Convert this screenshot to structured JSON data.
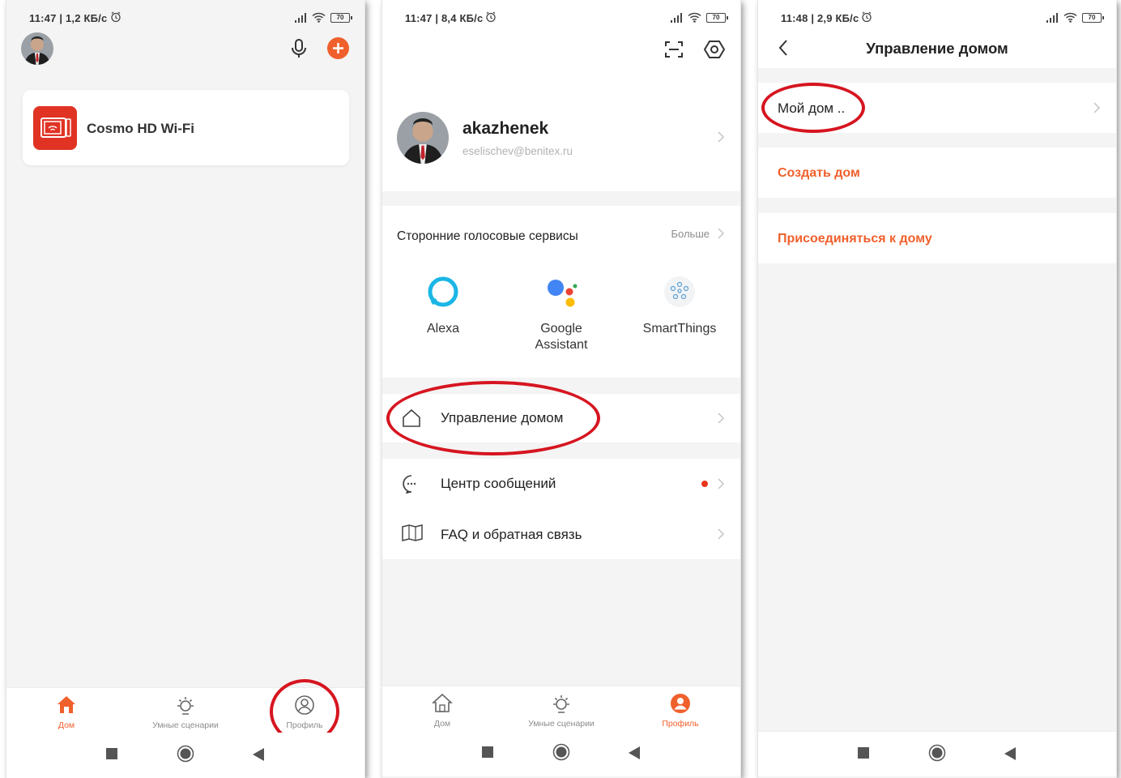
{
  "screens": [
    {
      "status": {
        "time": "11:47 | 1,2 КБ/с",
        "battery": "70"
      },
      "device": {
        "name": "Cosmo HD Wi-Fi"
      },
      "tabs": [
        {
          "label": "Дом"
        },
        {
          "label": "Умные сценарии"
        },
        {
          "label": "Профиль"
        }
      ]
    },
    {
      "status": {
        "time": "11:47 | 8,4 КБ/с",
        "battery": "70"
      },
      "profile": {
        "name": "akazhenek",
        "email": "eselischev@benitex.ru"
      },
      "voice": {
        "title": "Сторонние голосовые сервисы",
        "more": "Больше",
        "services": [
          {
            "line1": "Alexa",
            "line2": ""
          },
          {
            "line1": "Google",
            "line2": "Assistant"
          },
          {
            "line1": "SmartThings",
            "line2": ""
          }
        ]
      },
      "rows": {
        "home_management": "Управление домом",
        "messages": "Центр сообщений",
        "faq": "FAQ и обратная связь"
      },
      "tabs": [
        {
          "label": "Дом"
        },
        {
          "label": "Умные сценарии"
        },
        {
          "label": "Профиль"
        }
      ]
    },
    {
      "status": {
        "time": "11:48 | 2,9 КБ/с",
        "battery": "70"
      },
      "title": "Управление домом",
      "my_home": "Мой дом ..",
      "create_home": "Создать дом",
      "join_home": "Присоединяться к дому"
    }
  ],
  "colors": {
    "accent": "#f0602c",
    "annotation": "#d61520",
    "device_icon": "#e03324"
  },
  "icons": [
    "avatar-icon",
    "microphone-icon",
    "add-icon",
    "scan-icon",
    "settings-icon",
    "alexa-icon",
    "google-assistant-icon",
    "smartthings-icon",
    "home-icon",
    "message-icon",
    "book-icon",
    "sun-icon",
    "profile-icon",
    "back-icon",
    "chevron-right-icon"
  ]
}
